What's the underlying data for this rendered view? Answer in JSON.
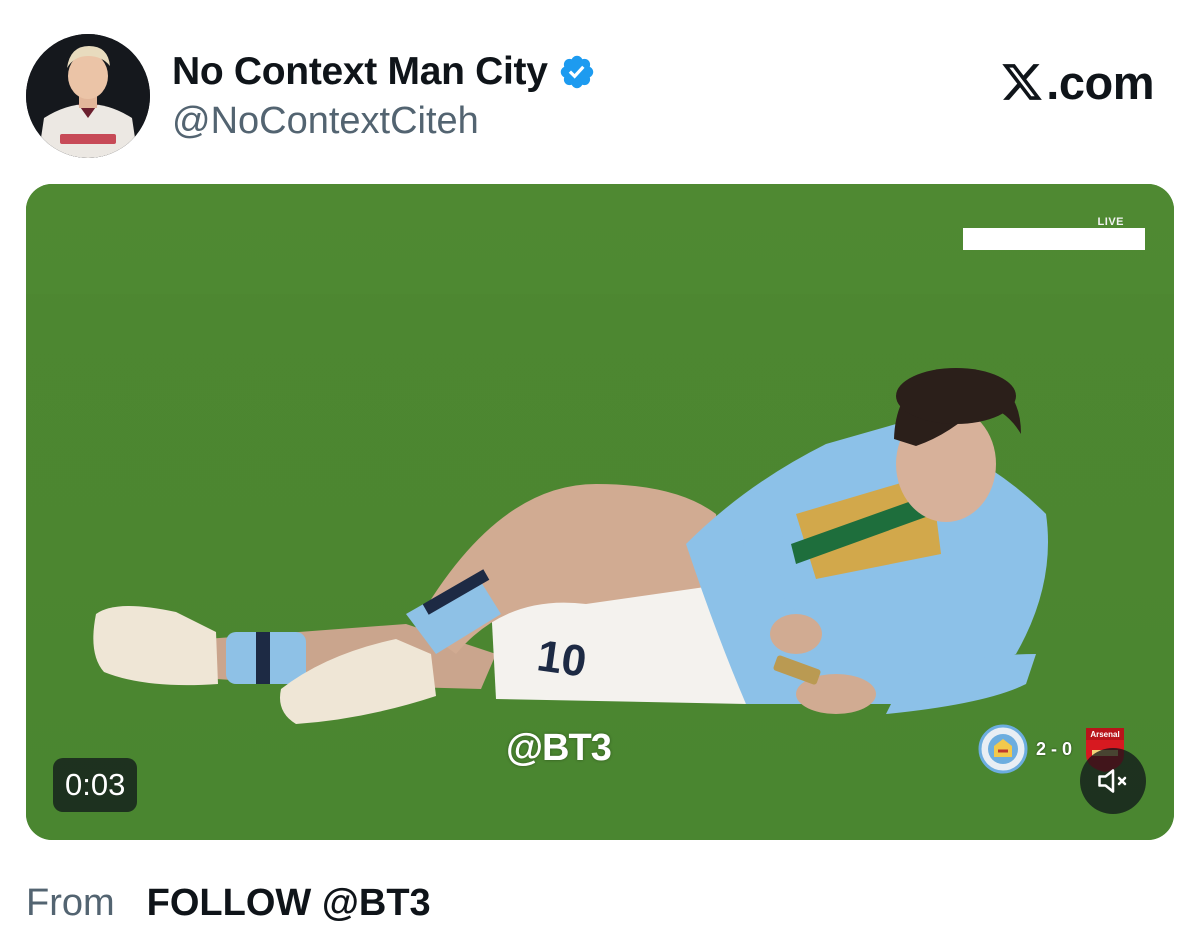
{
  "author": {
    "display_name": "No Context Man City",
    "handle": "@NoContextCiteh",
    "verified": true,
    "verified_color": "#1d9bf0",
    "avatar_icon": "profile-photo"
  },
  "site": {
    "logo_text": ".com",
    "logo_icon": "x-logo-icon"
  },
  "video": {
    "live_label": "LIVE",
    "watermark": "@BT3",
    "scoreboard": {
      "score": "2 - 0",
      "home_crest_icon": "man-city-crest-icon",
      "away_crest_icon": "arsenal-crest-icon",
      "away_crest_text": "Arsenal"
    },
    "timer": "0:03",
    "muted": true,
    "mute_icon": "speaker-muted-icon"
  },
  "source": {
    "prefix": "From",
    "name": "FOLLOW @BT3"
  },
  "colors": {
    "text_primary": "#0f1419",
    "text_secondary": "#536471",
    "pitch_green": "#4f8a33",
    "kit_sky_blue": "#8cc1e8"
  }
}
